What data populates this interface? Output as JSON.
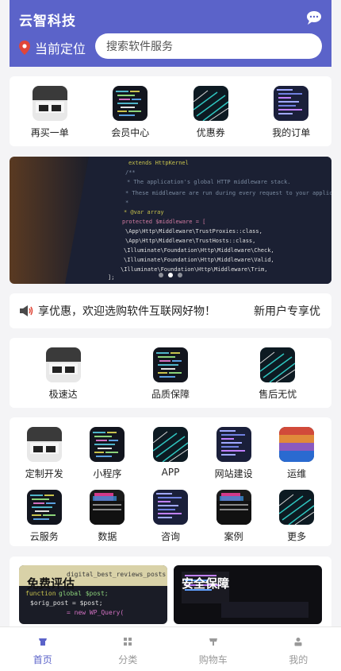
{
  "header": {
    "brand": "云智科技",
    "location_label": "当前定位",
    "search_placeholder": "搜索软件服务",
    "bg_color": "#5b63c9"
  },
  "quick_links": [
    {
      "label": "再买一单",
      "icon": "code-photo"
    },
    {
      "label": "会员中心",
      "icon": "code-photo"
    },
    {
      "label": "优惠券",
      "icon": "code-photo"
    },
    {
      "label": "我的订单",
      "icon": "code-photo"
    }
  ],
  "banner": {
    "slide_count": 3,
    "active_slide": 1
  },
  "notice": {
    "icon": "speaker-icon",
    "text": "享优惠，欢迎选购软件互联网好物！",
    "text2": "新用户专享优"
  },
  "features": [
    {
      "label": "极速达"
    },
    {
      "label": "品质保障"
    },
    {
      "label": "售后无忧"
    }
  ],
  "categories": [
    {
      "label": "定制开发"
    },
    {
      "label": "小程序"
    },
    {
      "label": "APP"
    },
    {
      "label": "网站建设"
    },
    {
      "label": "运维"
    },
    {
      "label": "云服务"
    },
    {
      "label": "数据"
    },
    {
      "label": "咨询"
    },
    {
      "label": "案例"
    },
    {
      "label": "更多"
    }
  ],
  "promos": [
    {
      "title": "免费评估"
    },
    {
      "title": "安全保障"
    }
  ],
  "tabbar": {
    "accent": "#5b63c9",
    "items": [
      {
        "label": "首页",
        "icon": "home-icon",
        "active": true
      },
      {
        "label": "分类",
        "icon": "grid-icon",
        "active": false
      },
      {
        "label": "购物车",
        "icon": "cart-icon",
        "active": false
      },
      {
        "label": "我的",
        "icon": "user-icon",
        "active": false
      }
    ]
  }
}
